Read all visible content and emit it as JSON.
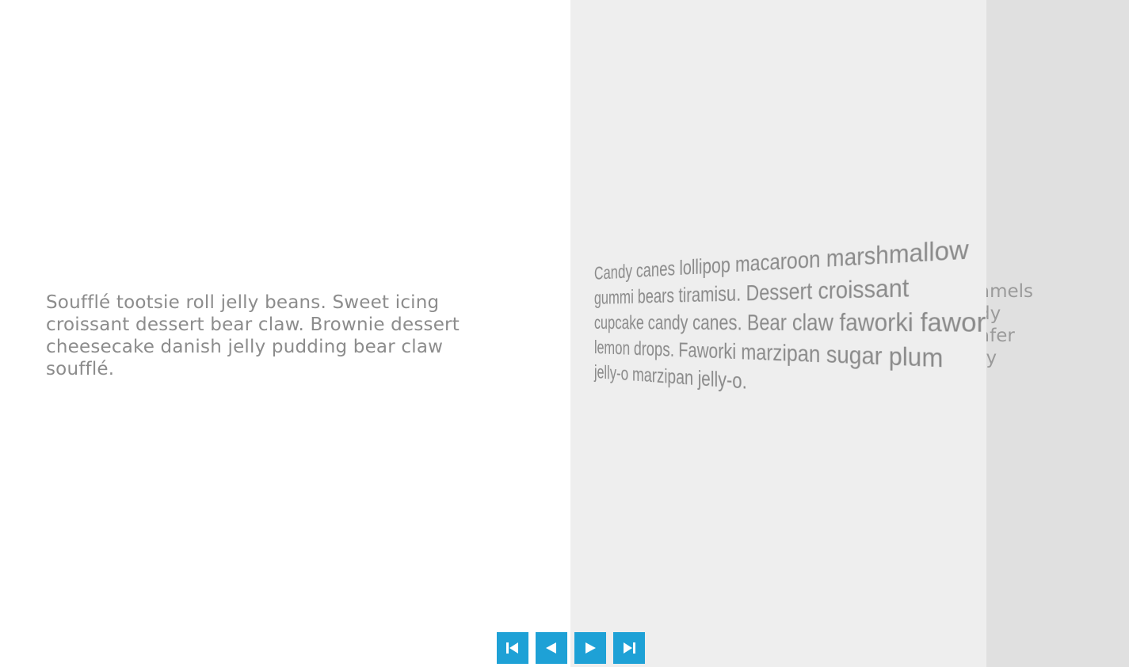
{
  "slides": {
    "current": {
      "text": "Soufflé tootsie roll jelly beans. Sweet icing croissant dessert bear claw. Brownie dessert cheesecake danish jelly pudding bear claw soufflé."
    },
    "next": {
      "lines": [
        "Candy canes lollipop macaroon marshmallow",
        "gummi bears tiramisu. Dessert croissant",
        "cupcake candy canes. Bear claw faworki faworki",
        "lemon drops. Faworki marzipan sugar plum",
        "jelly-o marzipan jelly-o."
      ]
    },
    "after_next": {
      "lines": [
        "amels",
        "dy",
        "afer",
        "ry"
      ]
    }
  },
  "nav": {
    "first_icon": "skip-to-first-icon",
    "prev_icon": "previous-icon",
    "next_icon": "next-icon",
    "last_icon": "skip-to-last-icon",
    "accent_color": "#1ea1d6"
  }
}
